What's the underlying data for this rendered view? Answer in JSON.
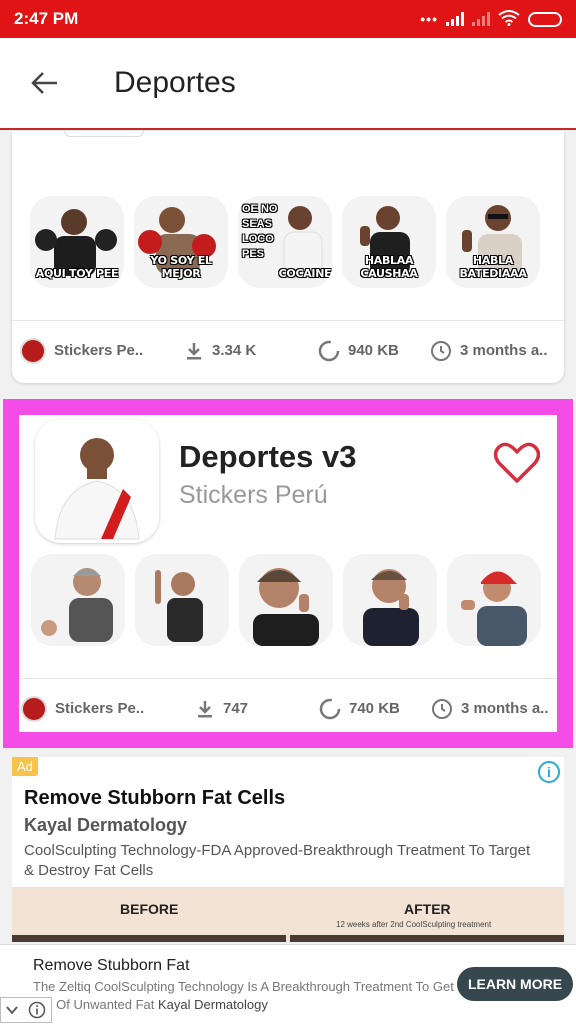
{
  "status_bar": {
    "time": "2:47 PM",
    "icons": [
      "dots-icon",
      "signal-icon",
      "signal-dim-icon",
      "wifi-icon",
      "battery-icon"
    ]
  },
  "app_bar": {
    "title": "Deportes",
    "back_icon": "arrow-left-icon"
  },
  "packs": [
    {
      "title": "",
      "author": "Stickers Perú",
      "stickers": [
        {
          "caption": "AQUI TOY PEE"
        },
        {
          "caption": "YO SOY EL MEJOR"
        },
        {
          "caption_top": "OE NO SEAS LOCO PES",
          "caption": "COCAINE"
        },
        {
          "caption": "HABLAA CAUSHAA"
        },
        {
          "caption": "HABLA BATEDIAAA"
        }
      ],
      "meta": {
        "author": "Stickers Pe..",
        "downloads": "3.34 K",
        "size": "940 KB",
        "updated": "3 months a.."
      }
    },
    {
      "title": "Deportes v3",
      "author": "Stickers Perú",
      "favorite_icon": "heart-outline-icon",
      "stickers": [
        {},
        {},
        {},
        {},
        {}
      ],
      "meta": {
        "author": "Stickers Pe..",
        "downloads": "747",
        "size": "740 KB",
        "updated": "3 months a.."
      }
    }
  ],
  "ad": {
    "badge": "Ad",
    "info_icon": "info-icon",
    "headline": "Remove Stubborn Fat Cells",
    "advertiser": "Kayal Dermatology",
    "body": "CoolSculpting Technology-FDA Approved-Breakthrough Treatment To Target & Destroy Fat Cells",
    "before_label": "BEFORE",
    "after_label": "AFTER",
    "after_note": "12 weeks after 2nd CoolSculpting treatment"
  },
  "banner": {
    "headline": "Remove Stubborn Fat",
    "body": "The Zeltiq CoolSculpting Technology Is A Breakthrough Treatment To Get Rid Of Unwanted Fat",
    "advertiser": "Kayal Dermatology",
    "cta": "LEARN MORE",
    "close_icons": [
      "chevron-down-icon",
      "info-icon"
    ]
  },
  "colors": {
    "status_bar": "#e01414",
    "accent_red": "#c62828",
    "highlight": "#f44ce6",
    "cta": "#37474f"
  }
}
